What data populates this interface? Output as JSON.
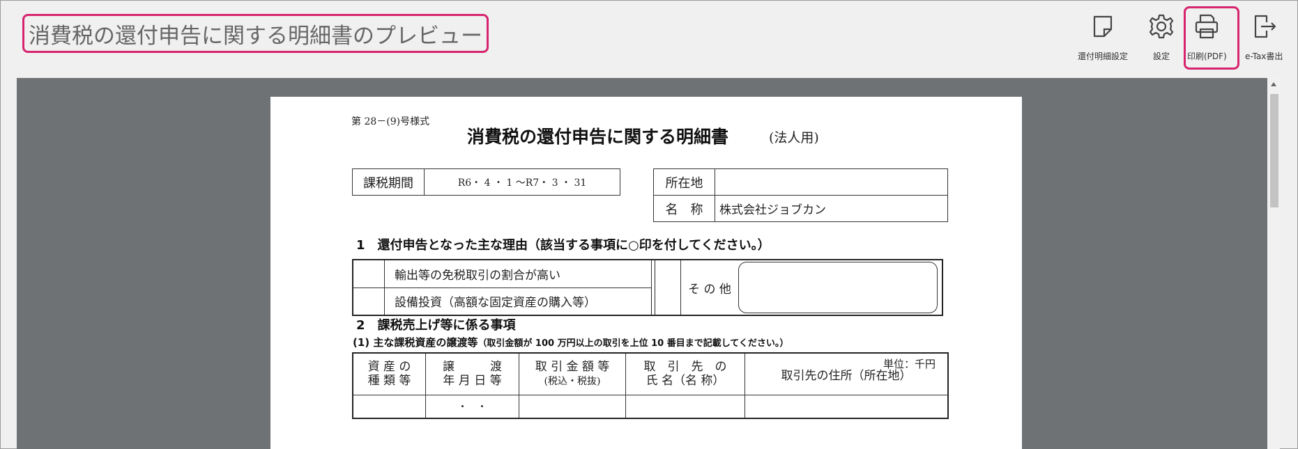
{
  "header": {
    "title": "消費税の還付申告に関する明細書のプレビュー"
  },
  "toolbar": {
    "items": [
      {
        "label": "還付明細設定",
        "icon": "note-icon"
      },
      {
        "label": "設定",
        "icon": "gear-icon"
      },
      {
        "label": "印刷(PDF)",
        "icon": "printer-icon"
      },
      {
        "label": "e-Tax書出",
        "icon": "export-icon"
      }
    ]
  },
  "document": {
    "form_id": "第 28－(9)号様式",
    "title": "消費税の還付申告に関する明細書",
    "subtitle": "(法人用)",
    "period_label": "課税期間",
    "period_value": "R6・ 4 ・ 1 〜R7・ 3 ・ 31",
    "address_label": "所在地",
    "address_value": "",
    "name_label": "名　称",
    "name_value": "株式会社ジョブカン",
    "section1_title": "1　還付申告となった主な理由（該当する事項に○印を付してください。）",
    "reasons": [
      "輸出等の免税取引の割合が高い",
      "設備投資（高額な固定資産の購入等）"
    ],
    "reason_other_label": "そ の 他",
    "section2_title": "2　課税売上げ等に係る事項",
    "section2_sub_a": "(1)  主な課税資産の譲渡等",
    "section2_sub_b": "（取引金額が 100 万円以上の取引を上位 10 番目まで記載してください。）",
    "unit": "単位：千円",
    "columns": [
      {
        "line1": "資 産 の",
        "line2": "種 類 等"
      },
      {
        "line1": "譲　　　渡",
        "line2": "年 月 日 等"
      },
      {
        "line1": "取 引 金 額 等",
        "line2": "(税込・税抜)"
      },
      {
        "line1": "取　引　先　の",
        "line2": "氏 名（名 称）"
      },
      {
        "line1": "取引先の住所（所在地）",
        "line2": ""
      }
    ],
    "row1_date": "・　・"
  }
}
